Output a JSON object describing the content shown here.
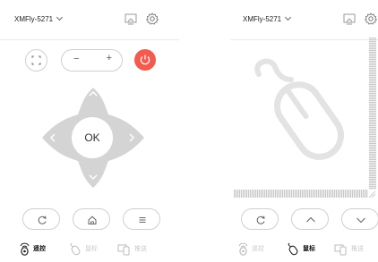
{
  "left_panel": {
    "device_name": "XMFly-5271",
    "ok_label": "OK",
    "volume_minus": "−",
    "volume_plus": "+",
    "tabs": [
      {
        "label": "遥控",
        "active": true
      },
      {
        "label": "鼠标",
        "active": false
      },
      {
        "label": "推送",
        "active": false
      }
    ]
  },
  "right_panel": {
    "device_name": "XMFly-5271",
    "tabs": [
      {
        "label": "遥控",
        "active": false
      },
      {
        "label": "鼠标",
        "active": true
      },
      {
        "label": "推送",
        "active": false
      }
    ]
  },
  "colors": {
    "accent_power": "#f25b4e",
    "dpad_fill": "#d4d4d4",
    "button_border": "#cfcfcf",
    "mouse_outline": "#e3e3e3"
  }
}
